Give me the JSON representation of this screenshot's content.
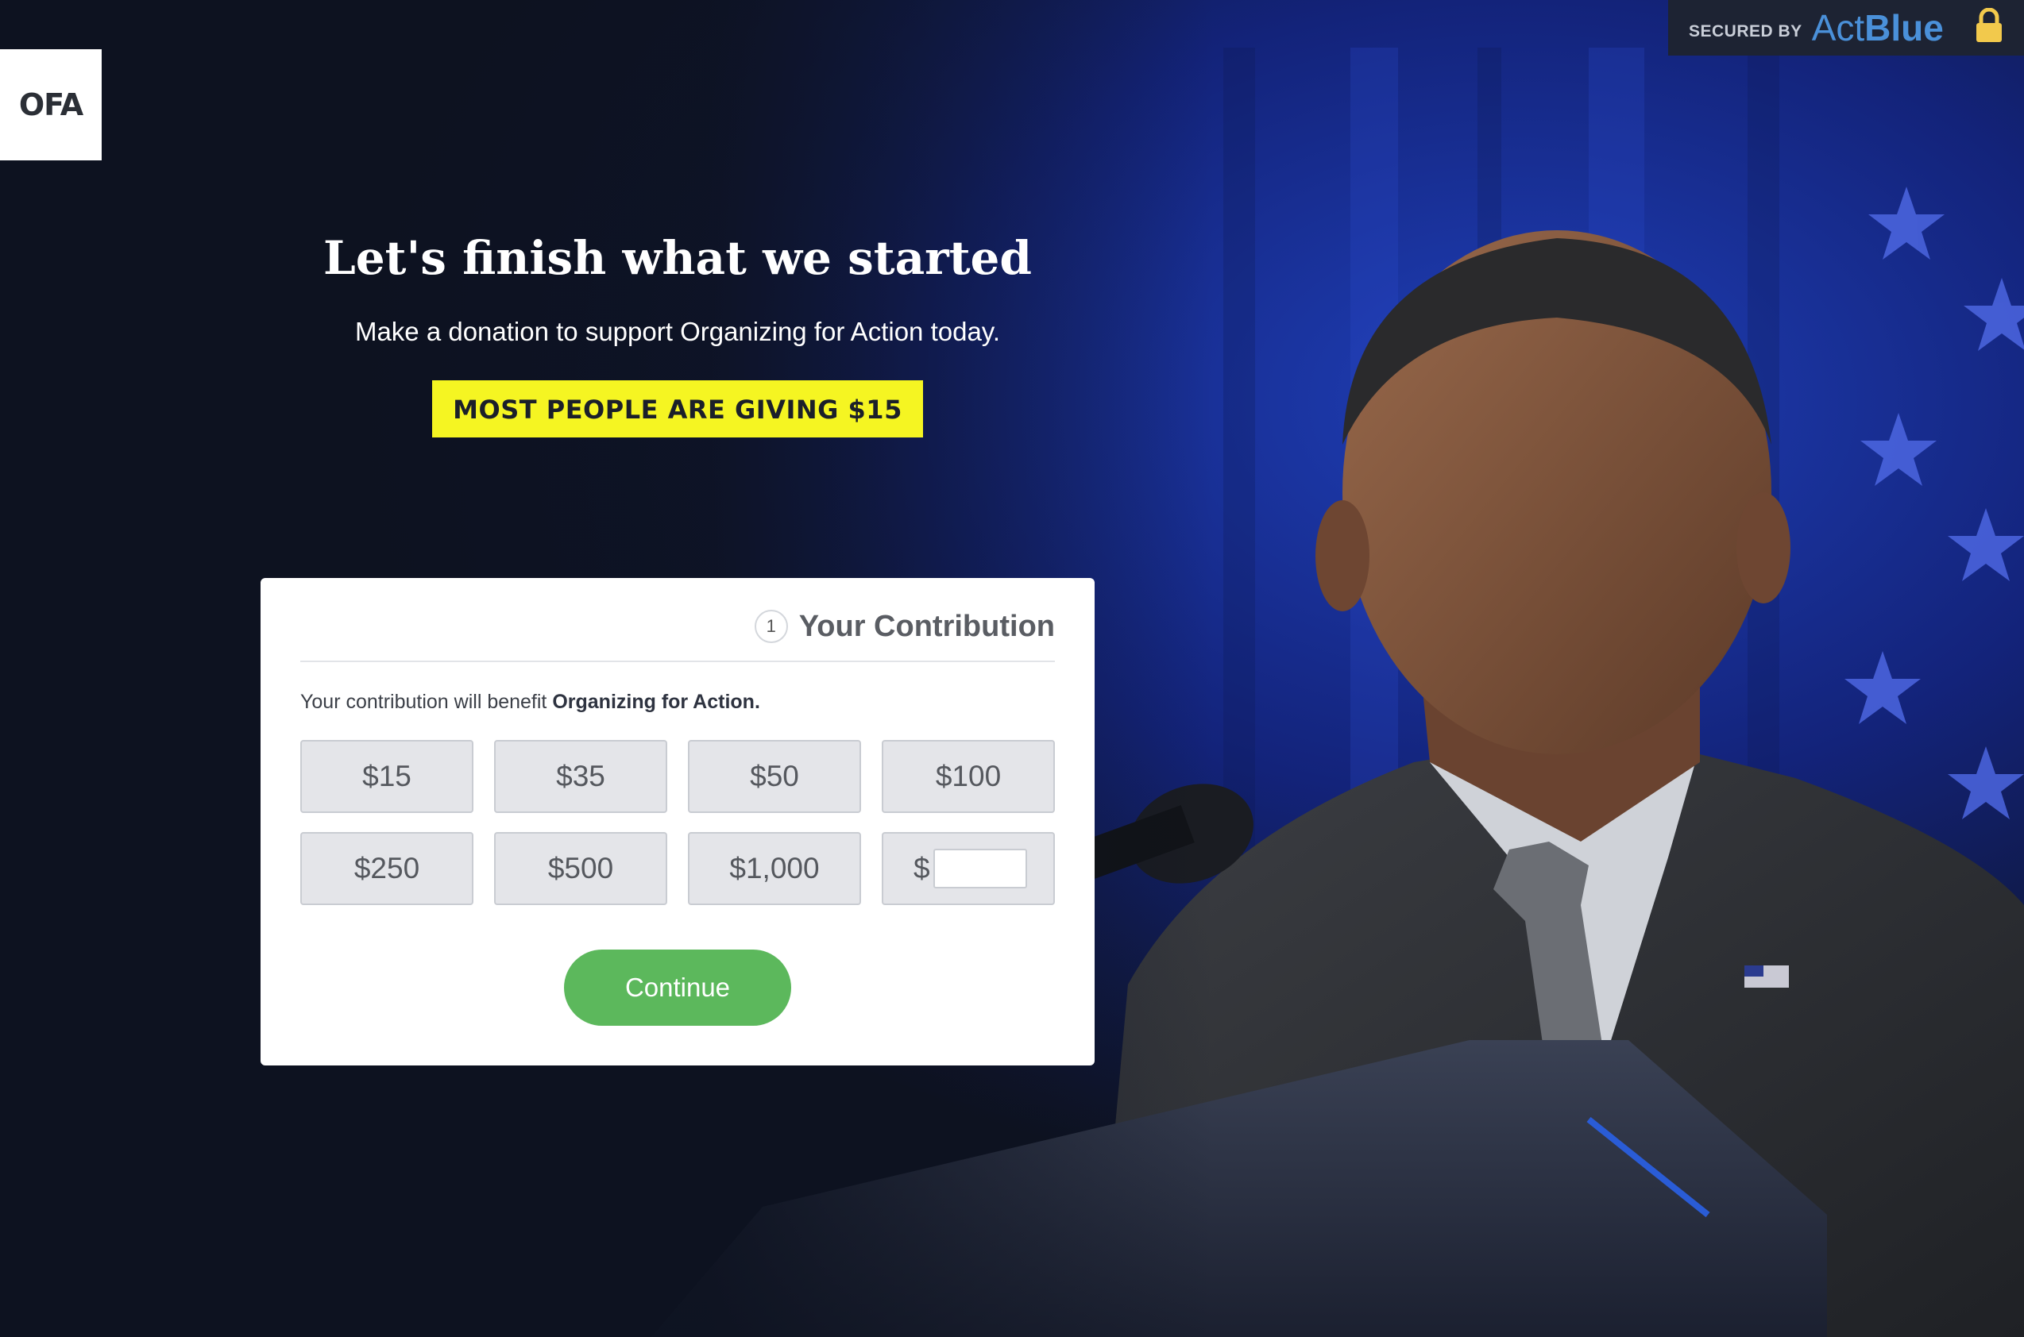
{
  "brand": {
    "logo_text": "OFA"
  },
  "secured": {
    "prefix": "SECURED BY",
    "brand_act": "Act",
    "brand_blue": "Blue"
  },
  "hero": {
    "title": "Let's finish what we started",
    "subtitle": "Make a donation to support Organizing for Action today.",
    "banner": "MOST PEOPLE ARE GIVING $15"
  },
  "contribution": {
    "step_number": "1",
    "title": "Your Contribution",
    "benefit_prefix": "Your contribution will benefit ",
    "benefit_org": "Organizing for Action.",
    "amounts": [
      "$15",
      "$35",
      "$50",
      "$100",
      "$250",
      "$500",
      "$1,000"
    ],
    "other_currency": "$",
    "other_value": "",
    "continue_label": "Continue"
  },
  "colors": {
    "banner_bg": "#f5f522",
    "continue_bg": "#5cb85c",
    "actblue": "#4a90d9",
    "page_bg": "#0d1220"
  }
}
